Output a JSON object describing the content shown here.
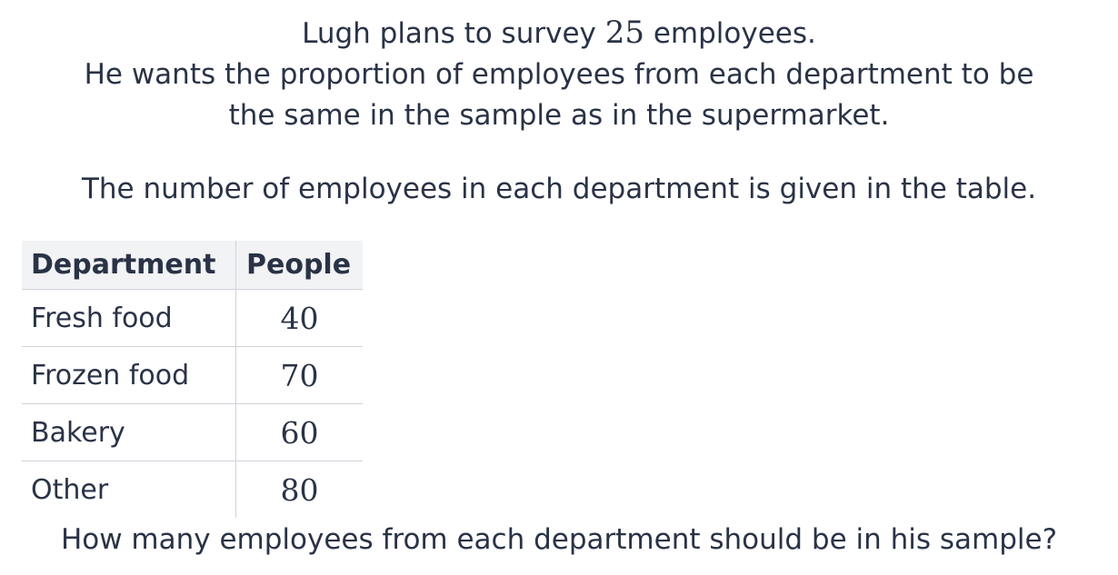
{
  "intro": {
    "line1_before": "Lugh plans to survey ",
    "line1_number": "25",
    "line1_after": " employees.",
    "line2": "He wants the proportion of employees from each department to be",
    "line3": "the same in the sample as in the supermarket."
  },
  "table_note": "The number of employees in each department is given in the table.",
  "table": {
    "headers": [
      "Department",
      "People"
    ],
    "rows": [
      {
        "department": "Fresh food",
        "people": "40"
      },
      {
        "department": "Frozen food",
        "people": "70"
      },
      {
        "department": "Bakery",
        "people": "60"
      },
      {
        "department": "Other",
        "people": "80"
      }
    ]
  },
  "question": "How many employees from each department should be in his sample?"
}
